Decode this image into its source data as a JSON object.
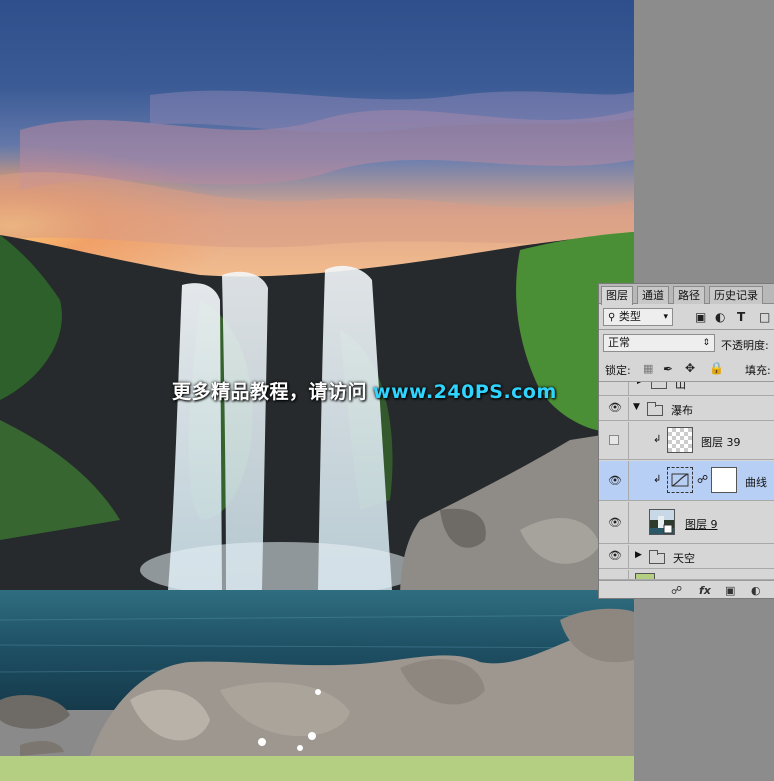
{
  "watermark": {
    "text": "更多精品教程，请访问",
    "site": "www.240PS.com"
  },
  "colors": {
    "canvas_bg": "#8a8a8a",
    "bottom_strip": "#b5cf82",
    "watermark_site": "#2fd4ff",
    "selected_layer": "#b8cff5",
    "panel_bg": "#d6d6d6"
  },
  "panel": {
    "tabs": [
      "图层",
      "通道",
      "路径",
      "历史记录"
    ],
    "active_tab": "图层",
    "filter_label": "类型",
    "filter_icon": "search-icon",
    "filter_icons": [
      "image-filter-icon",
      "adjustment-filter-icon",
      "text-filter-icon",
      "shape-filter-icon"
    ],
    "filter_text_icon_label": "T",
    "blend_mode": "正常",
    "opacity_label": "不透明度:",
    "lock_label": "锁定:",
    "fill_label": "填充:",
    "lock_icons": [
      "lock-transparent-icon",
      "lock-brush-icon",
      "lock-move-icon",
      "lock-all-icon"
    ],
    "layers": [
      {
        "name": "山",
        "type": "group",
        "expanded": false,
        "visible": true
      },
      {
        "name": "瀑布",
        "type": "group",
        "expanded": true,
        "visible": true
      },
      {
        "name": "图层 39",
        "type": "pixel",
        "clipped": true,
        "visible": false
      },
      {
        "name": "曲线",
        "type": "adjustment",
        "clipped": true,
        "visible": true,
        "selected": true
      },
      {
        "name": "图层 9",
        "type": "smart",
        "visible": true
      },
      {
        "name": "天空",
        "type": "group",
        "expanded": false,
        "visible": true
      }
    ],
    "footer_icons": [
      "link-icon",
      "fx-icon",
      "mask-icon",
      "adjustment-icon"
    ],
    "footer_fx_label": "fx"
  }
}
